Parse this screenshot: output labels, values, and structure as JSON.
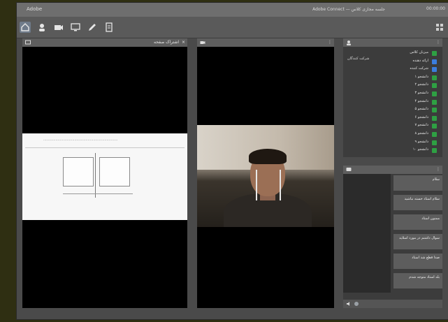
{
  "titlebar": {
    "app_title": "Adobe",
    "window_title": "Adobe Connect — جلسه مجازی کلاس",
    "clock": "00:00:00"
  },
  "toolbar": {
    "icons": [
      "home-icon",
      "user-icon",
      "camera-icon",
      "monitor-icon",
      "pen-icon",
      "document-icon"
    ]
  },
  "share_panel": {
    "title": "اشتراک صفحه",
    "slide_text": "..................................................................."
  },
  "video_panel": {
    "title": ""
  },
  "attendees": {
    "badge": "شرکت کنندگان",
    "items": [
      {
        "name": "میزبان کلاس",
        "color": "#2ea043"
      },
      {
        "name": "ارائه دهنده",
        "color": "#3b7ddd"
      },
      {
        "name": "شرکت کننده",
        "color": "#3b7ddd"
      },
      {
        "name": "دانشجو ۱",
        "color": "#2ea043"
      },
      {
        "name": "دانشجو ۲",
        "color": "#2ea043"
      },
      {
        "name": "دانشجو ۳",
        "color": "#2ea043"
      },
      {
        "name": "دانشجو ۴",
        "color": "#2ea043"
      },
      {
        "name": "دانشجو ۵",
        "color": "#2ea043"
      },
      {
        "name": "دانشجو ۶",
        "color": "#2ea043"
      },
      {
        "name": "دانشجو ۷",
        "color": "#2ea043"
      },
      {
        "name": "دانشجو ۸",
        "color": "#2ea043"
      },
      {
        "name": "دانشجو ۹",
        "color": "#2ea043"
      },
      {
        "name": "دانشجو ۱۰",
        "color": "#2ea043"
      }
    ]
  },
  "chat": {
    "messages": [
      "سلام",
      "سلام استاد خسته نباشید",
      "ممنون استاد",
      "سوال داشتم در مورد اسلاید",
      "صدا قطع شد استاد",
      "بله استاد متوجه شدم"
    ]
  }
}
